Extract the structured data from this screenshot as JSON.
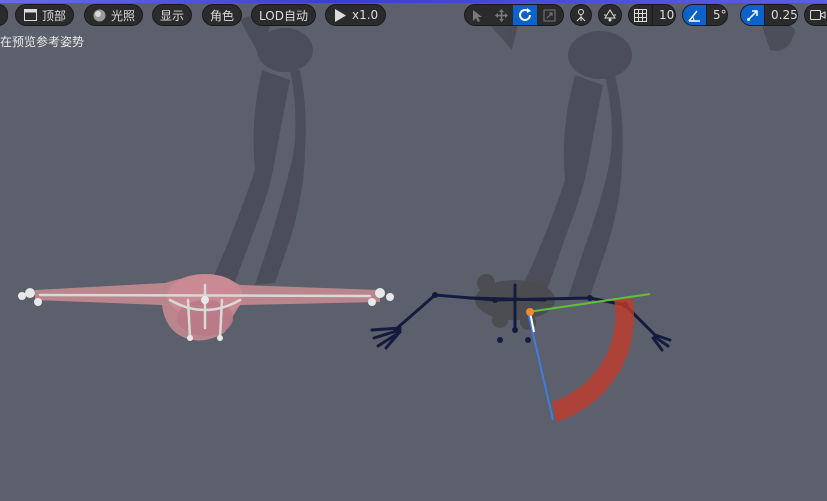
{
  "toolbar": {
    "view_label": "顶部",
    "lighting_label": "光照",
    "show_label": "显示",
    "character_label": "角色",
    "lod_label": "LOD自动",
    "play_speed_label": "x1.0",
    "grid_snap_value": "10",
    "angle_snap_value": "5°",
    "scale_snap_value": "0.25",
    "active_transform_tool": "rotate"
  },
  "viewport": {
    "preview_notice": "在预览参考姿势"
  },
  "icons": [
    "menu-icon",
    "viewport-icon",
    "lighting-icon",
    "play-icon",
    "select-icon",
    "move-icon",
    "rotate-icon",
    "scale-icon",
    "world-local-icon",
    "surface-snap-icon",
    "grid-icon",
    "angle-icon",
    "scale-snap-icon",
    "camera-icon"
  ],
  "colors": {
    "background": "#5c606c",
    "toolbar_button": "#2b2b2e",
    "active_blue": "#0b62c9",
    "rotate_arc": "#c0392b",
    "skeleton_dark": "#151b3c",
    "reference_mesh": "#c48b92",
    "axis_green": "#5fbf3a",
    "axis_blue": "#3f7be0"
  }
}
